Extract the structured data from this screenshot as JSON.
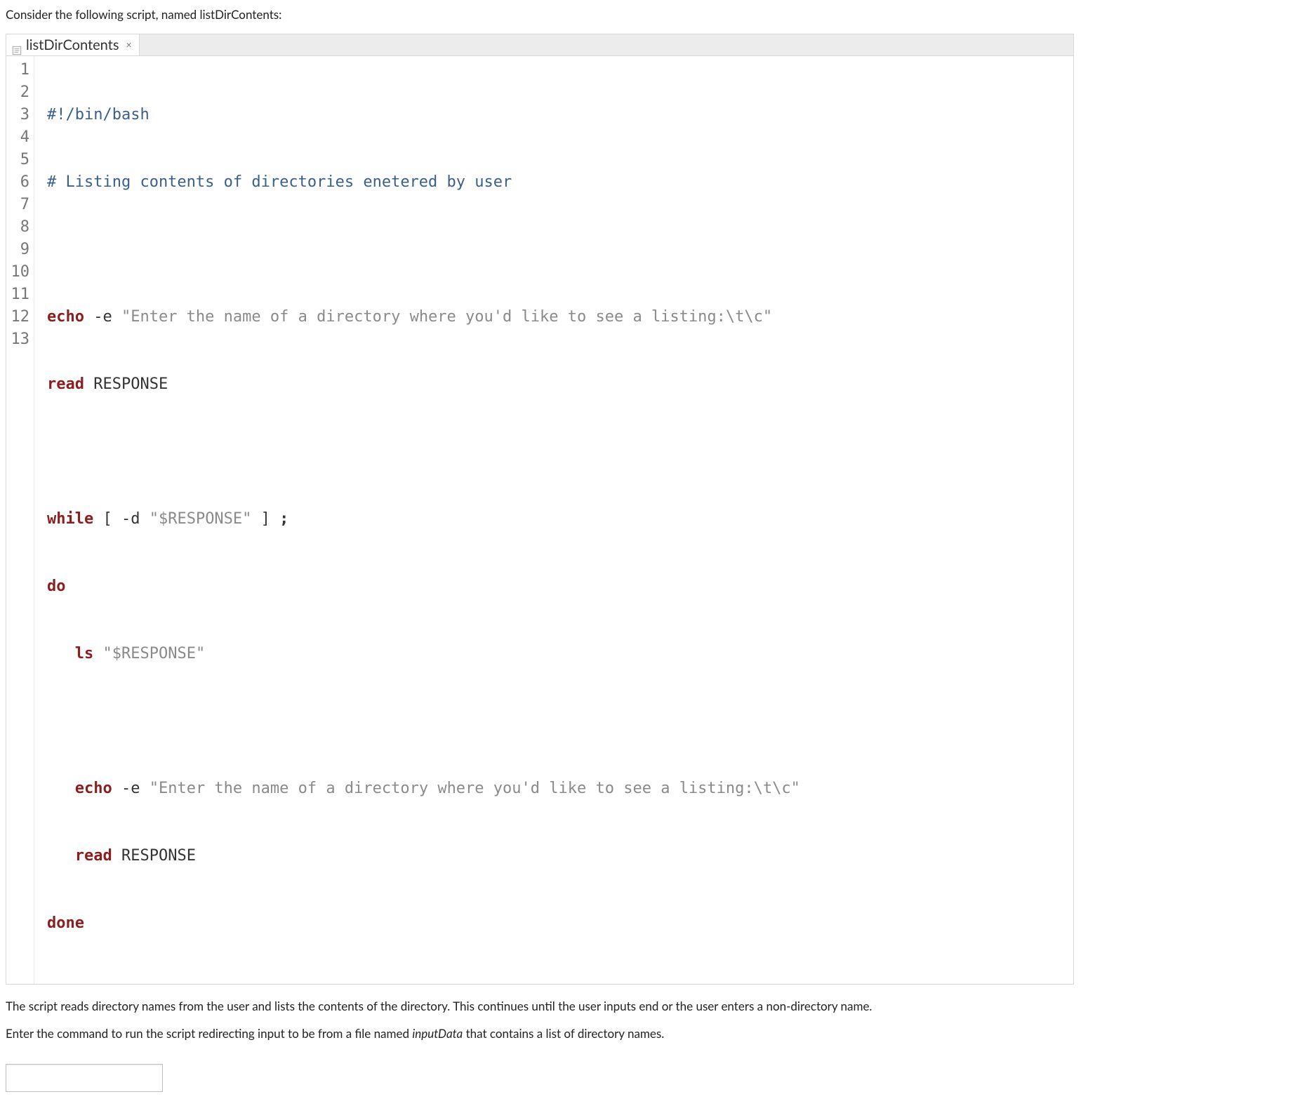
{
  "intro": "Consider the following script, named listDirContents:",
  "tab": {
    "filename": "listDirContents",
    "close_glyph": "×"
  },
  "code": {
    "line_numbers": [
      "1",
      "2",
      "3",
      "4",
      "5",
      "6",
      "7",
      "8",
      "9",
      "10",
      "11",
      "12",
      "13"
    ],
    "lines": {
      "l1": {
        "shebang": "#!/bin/bash"
      },
      "l2": {
        "comment": "# Listing contents of directories enetered by user"
      },
      "l3": {
        "blank": ""
      },
      "l4": {
        "cmd": "echo",
        "opt": " -e ",
        "str": "\"Enter the name of a directory where you'd like to see a listing:\\t\\c\""
      },
      "l5": {
        "cmd": "read",
        "var": " RESPONSE"
      },
      "l6": {
        "blank": ""
      },
      "l7": {
        "kw": "while",
        "mid": " [ -d ",
        "str": "\"$RESPONSE\"",
        "end": " ] ",
        "punc": ";"
      },
      "l8": {
        "kw": "do"
      },
      "l9": {
        "indent": "   ",
        "cmd": "ls",
        "sp": " ",
        "str": "\"$RESPONSE\""
      },
      "l10": {
        "blank": ""
      },
      "l11": {
        "indent": "   ",
        "cmd": "echo",
        "opt": " -e ",
        "str": "\"Enter the name of a directory where you'd like to see a listing:\\t\\c\""
      },
      "l12": {
        "indent": "   ",
        "cmd": "read",
        "var": " RESPONSE"
      },
      "l13": {
        "kw": "done"
      }
    }
  },
  "description": "The script reads directory names from the user and lists the contents of the directory. This continues until the user inputs end or the user enters a non-directory name.",
  "prompt": {
    "before": "Enter the command to run the script redirecting input to be from a file named ",
    "filename": "inputData",
    "after": " that contains a list of directory names."
  },
  "answer": {
    "value": "",
    "placeholder": ""
  }
}
